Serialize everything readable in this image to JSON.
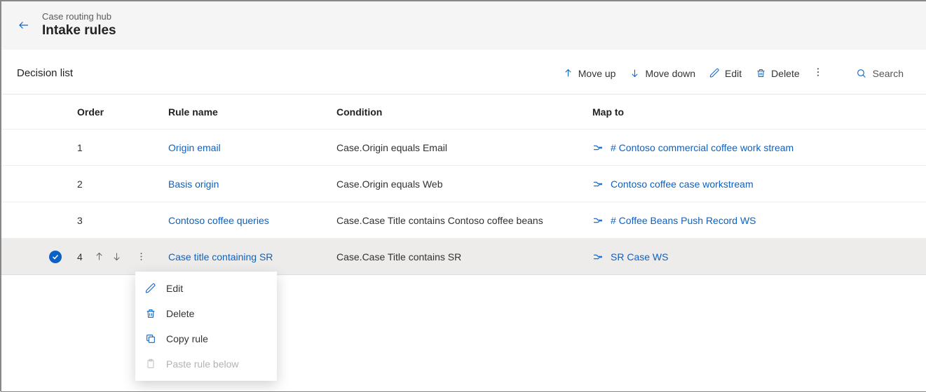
{
  "header": {
    "breadcrumb": "Case routing hub",
    "title": "Intake rules"
  },
  "section_label": "Decision list",
  "commands": {
    "move_up": "Move up",
    "move_down": "Move down",
    "edit": "Edit",
    "delete": "Delete",
    "search": "Search"
  },
  "columns": {
    "order": "Order",
    "rule_name": "Rule name",
    "condition": "Condition",
    "map_to": "Map to"
  },
  "rows": [
    {
      "order": "1",
      "rule_name": "Origin email",
      "condition": "Case.Origin equals Email",
      "map_to": "# Contoso commercial coffee work stream",
      "selected": false
    },
    {
      "order": "2",
      "rule_name": "Basis origin",
      "condition": "Case.Origin equals Web",
      "map_to": "Contoso coffee case workstream",
      "selected": false
    },
    {
      "order": "3",
      "rule_name": "Contoso coffee queries",
      "condition": "Case.Case Title contains Contoso coffee beans",
      "map_to": "# Coffee Beans Push Record WS",
      "selected": false
    },
    {
      "order": "4",
      "rule_name": "Case title containing SR",
      "condition": "Case.Case Title contains SR",
      "map_to": "SR Case WS",
      "selected": true
    }
  ],
  "context_menu": {
    "edit": "Edit",
    "delete": "Delete",
    "copy_rule": "Copy rule",
    "paste_rule_below": "Paste rule below"
  }
}
